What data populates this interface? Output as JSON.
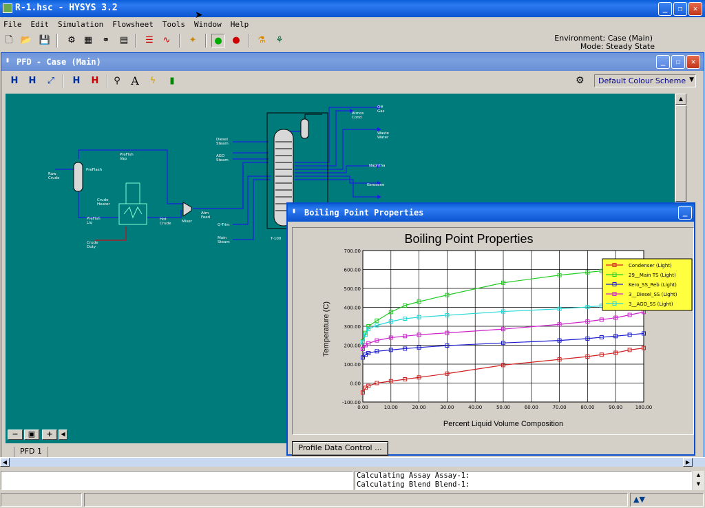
{
  "app": {
    "title": "R-1.hsc - HYSYS 3.2",
    "menu": [
      "File",
      "Edit",
      "Simulation",
      "Flowsheet",
      "Tools",
      "Window",
      "Help"
    ],
    "environment_label": "Environment: Case (Main)",
    "mode_label": "Mode: Steady State"
  },
  "pfd": {
    "title": "PFD - Case (Main)",
    "colour_scheme": "Default Colour Scheme",
    "tab_label": "PFD 1",
    "labels": {
      "raw_crude": "Raw\nCrude",
      "preflash": "PreFlash",
      "preflash_vap": "PreFlsh\nVap",
      "crude_heater": "Crude\nHeater",
      "preflash_liq": "PreFlsh\nLiq",
      "crude_duty": "Crude\nDuty",
      "hot_crude": "Hot\nCrude",
      "mixer": "Mixer",
      "atm_feed": "Atm\nFeed",
      "q_trim": "Q-Trim",
      "main_steam": "Main\nSteam",
      "diesel_steam": "Diesel\nSteam",
      "ago_steam": "AGO\nSteam",
      "t100": "T-100",
      "atmos_cond": "Atmos\nCond",
      "off_gas": "Off\nGas",
      "waste_water": "Waste\nWater",
      "naphtha": "Naphtha",
      "kerosene": "Kerosene"
    }
  },
  "bpp": {
    "title": "Boiling Point Properties",
    "button": "Profile Data Control ..."
  },
  "status": {
    "line1": "Calculating Assay Assay-1:",
    "line2": "Calculating Blend Blend-1:"
  },
  "chart_data": {
    "type": "line",
    "title": "Boiling Point Properties",
    "xlabel": "Percent Liquid Volume Composition",
    "ylabel": "Temperature (C)",
    "xlim": [
      0,
      100
    ],
    "ylim": [
      -100,
      700
    ],
    "x_ticks": [
      "0.00",
      "10.00",
      "20.00",
      "30.00",
      "40.00",
      "50.00",
      "60.00",
      "70.00",
      "80.00",
      "90.00",
      "100.00"
    ],
    "y_ticks": [
      "-100.00",
      "0.00",
      "100.00",
      "200.00",
      "300.00",
      "400.00",
      "500.00",
      "600.00",
      "700.00"
    ],
    "legend_position": "top-right",
    "grid": true,
    "series": [
      {
        "name": "Condenser (Light)",
        "color": "#d02020",
        "x": [
          0,
          1,
          2,
          5,
          10,
          15,
          20,
          30,
          50,
          70,
          80,
          85,
          90,
          95,
          100
        ],
        "y": [
          -50,
          -25,
          -15,
          0,
          10,
          20,
          30,
          50,
          95,
          125,
          140,
          150,
          160,
          175,
          185
        ]
      },
      {
        "name": "29__Main TS (Light)",
        "color": "#22cc22",
        "x": [
          0,
          1,
          2,
          5,
          10,
          15,
          20,
          30,
          50,
          70,
          80,
          85,
          90,
          95,
          100
        ],
        "y": [
          220,
          265,
          300,
          330,
          375,
          410,
          430,
          465,
          530,
          570,
          585,
          592,
          598,
          605,
          612
        ]
      },
      {
        "name": "Kero_SS_Reb (Light)",
        "color": "#1a1ad0",
        "x": [
          0,
          1,
          2,
          5,
          10,
          15,
          20,
          30,
          50,
          70,
          80,
          85,
          90,
          95,
          100
        ],
        "y": [
          135,
          150,
          158,
          168,
          175,
          182,
          188,
          198,
          212,
          225,
          235,
          242,
          248,
          255,
          262
        ]
      },
      {
        "name": "3__Diesel_SS (Light)",
        "color": "#cc22cc",
        "x": [
          0,
          1,
          2,
          5,
          10,
          15,
          20,
          30,
          50,
          70,
          80,
          85,
          90,
          95,
          100
        ],
        "y": [
          180,
          200,
          210,
          225,
          240,
          248,
          255,
          265,
          285,
          310,
          325,
          335,
          345,
          360,
          375
        ]
      },
      {
        "name": "3__AGO_SS (Light)",
        "color": "#22d8d8",
        "x": [
          0,
          1,
          2,
          5,
          10,
          15,
          20,
          30,
          50,
          70,
          80,
          85,
          90,
          95,
          100
        ],
        "y": [
          215,
          255,
          285,
          305,
          325,
          340,
          348,
          358,
          378,
          392,
          402,
          408,
          415,
          425,
          435
        ]
      }
    ]
  }
}
